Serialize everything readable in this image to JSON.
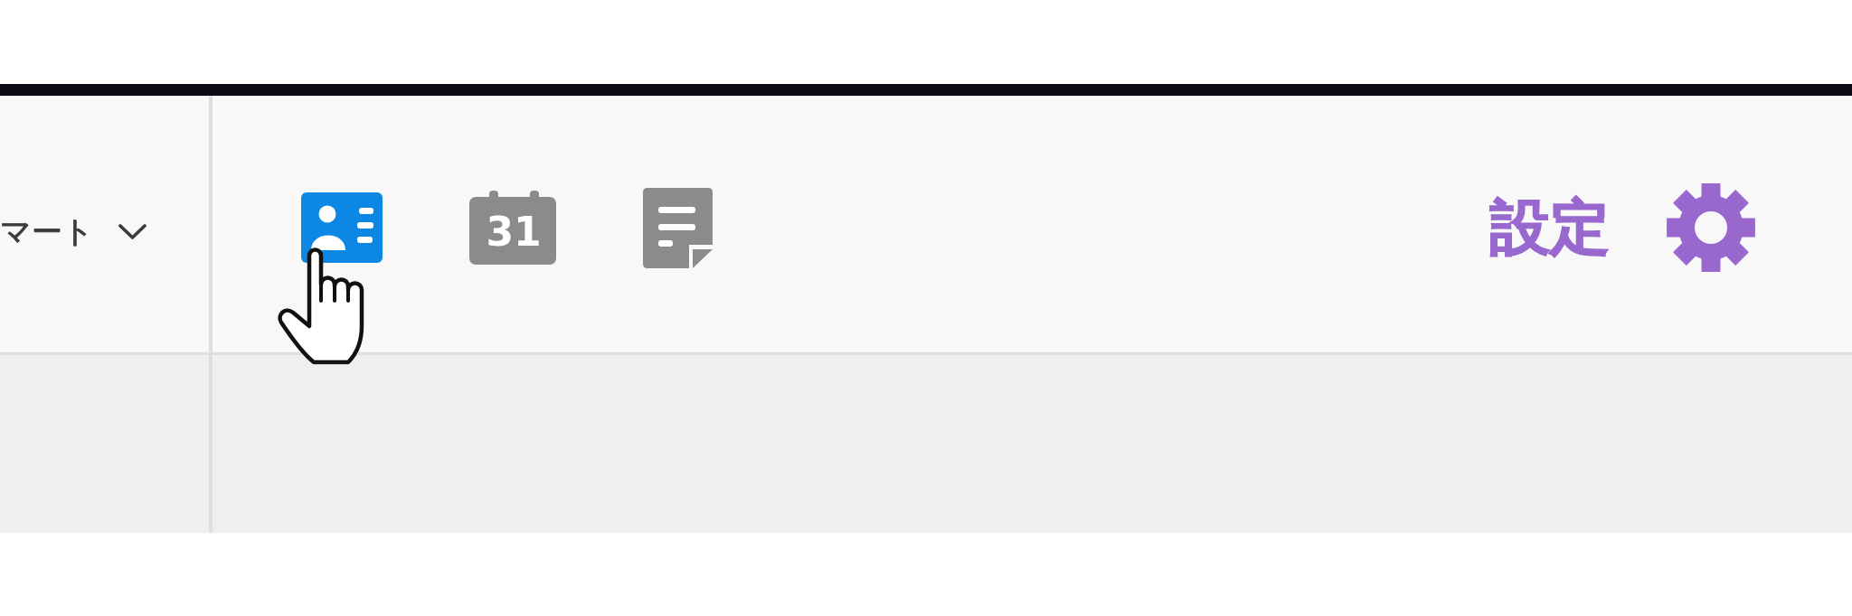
{
  "dropdown": {
    "label": "マート"
  },
  "apps": [
    {
      "kind": "contacts",
      "selected": true
    },
    {
      "kind": "calendar",
      "date": "31",
      "selected": false
    },
    {
      "kind": "notes",
      "selected": false
    }
  ],
  "settings": {
    "label": "設定"
  }
}
